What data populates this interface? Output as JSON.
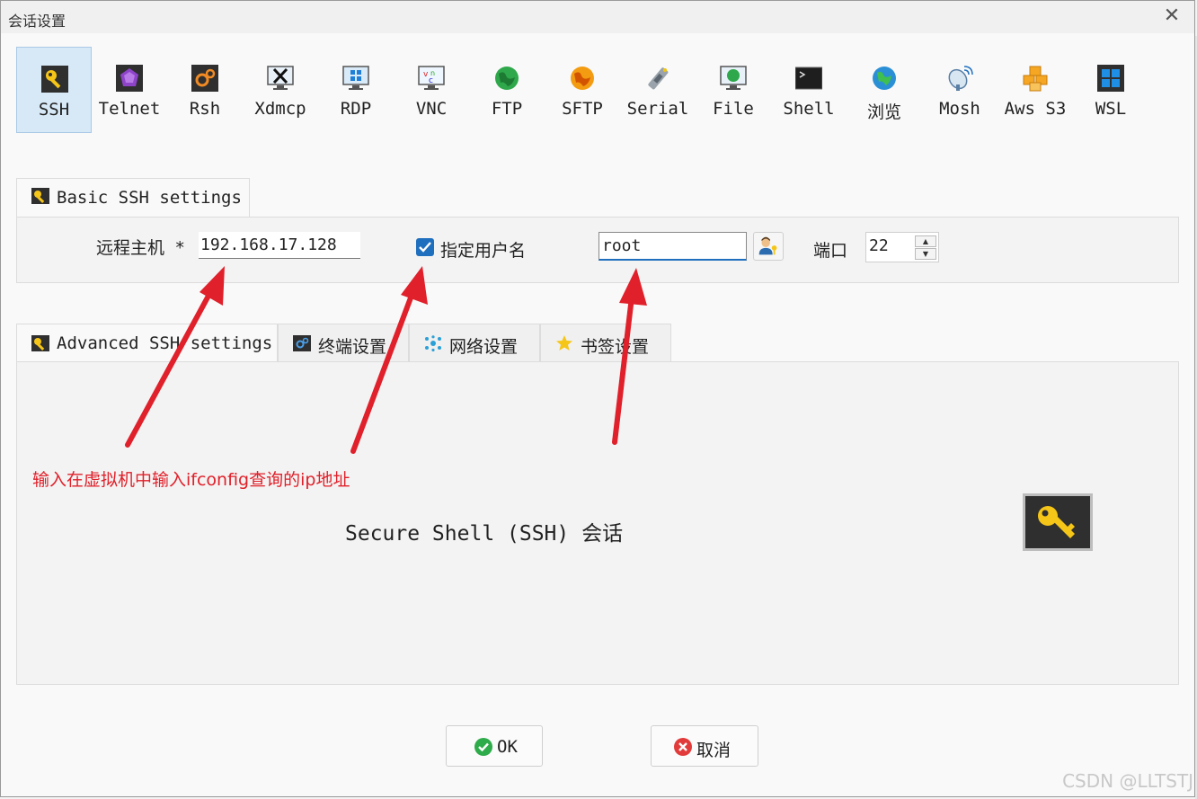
{
  "window": {
    "title": "会话设置",
    "close_glyph": "✕"
  },
  "session_types": [
    {
      "label": "SSH",
      "icon": "key-icon",
      "active": true
    },
    {
      "label": "Telnet",
      "icon": "telnet-icon"
    },
    {
      "label": "Rsh",
      "icon": "rsh-icon"
    },
    {
      "label": "Xdmcp",
      "icon": "xdmcp-icon"
    },
    {
      "label": "RDP",
      "icon": "rdp-icon"
    },
    {
      "label": "VNC",
      "icon": "vnc-icon"
    },
    {
      "label": "FTP",
      "icon": "ftp-icon"
    },
    {
      "label": "SFTP",
      "icon": "sftp-icon"
    },
    {
      "label": "Serial",
      "icon": "serial-icon"
    },
    {
      "label": "File",
      "icon": "file-icon"
    },
    {
      "label": "Shell",
      "icon": "shell-icon"
    },
    {
      "label": "浏览",
      "icon": "browser-icon"
    },
    {
      "label": "Mosh",
      "icon": "mosh-icon"
    },
    {
      "label": "Aws S3",
      "icon": "aws-s3-icon"
    },
    {
      "label": "WSL",
      "icon": "wsl-icon"
    }
  ],
  "basic": {
    "tab_label": "Basic SSH settings",
    "remote_host_label": "远程主机 *",
    "remote_host_value": "192.168.17.128",
    "specify_user_label": "指定用户名",
    "specify_user_checked": true,
    "username_value": "root",
    "port_label": "端口",
    "port_value": "22"
  },
  "advanced_tabs": [
    {
      "label": "Advanced SSH settings",
      "icon": "key-icon"
    },
    {
      "label": "终端设置",
      "icon": "terminal-settings-icon"
    },
    {
      "label": "网络设置",
      "icon": "network-settings-icon"
    },
    {
      "label": "书签设置",
      "icon": "star-icon"
    }
  ],
  "session_description": "Secure Shell (SSH) 会话",
  "annotation_text": "输入在虚拟机中输入ifconfig查询的ip地址",
  "buttons": {
    "ok": "OK",
    "cancel": "取消"
  },
  "watermark": "CSDN @LLTSTJ",
  "colors": {
    "annotation": "#e0202a",
    "accent": "#1f6fbf",
    "active_tool_bg": "#d7e8f7"
  }
}
